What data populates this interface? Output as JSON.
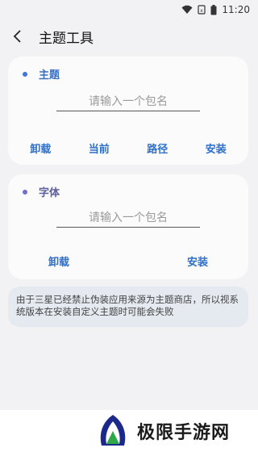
{
  "status_bar": {
    "time": "11:20"
  },
  "app_bar": {
    "title": "主题工具"
  },
  "theme_section": {
    "label": "主题",
    "input_placeholder": "请输入一个包名",
    "input_value": "",
    "actions": [
      "卸载",
      "当前",
      "路径",
      "安装"
    ]
  },
  "font_section": {
    "label": "字体",
    "input_placeholder": "请输入一个包名",
    "input_value": "",
    "actions": [
      "卸载",
      "安装"
    ]
  },
  "notice": {
    "text": "由于三星已经禁止伪装应用来源为主题商店，所以视系统版本在安装自定义主题时可能会失败"
  },
  "watermark": {
    "brand": "极限手游网"
  },
  "colors": {
    "accent": "#2e6fc8",
    "background": "#f2f2f4",
    "card": "#fbfbfc",
    "notice_bg": "#e5e9f0"
  }
}
